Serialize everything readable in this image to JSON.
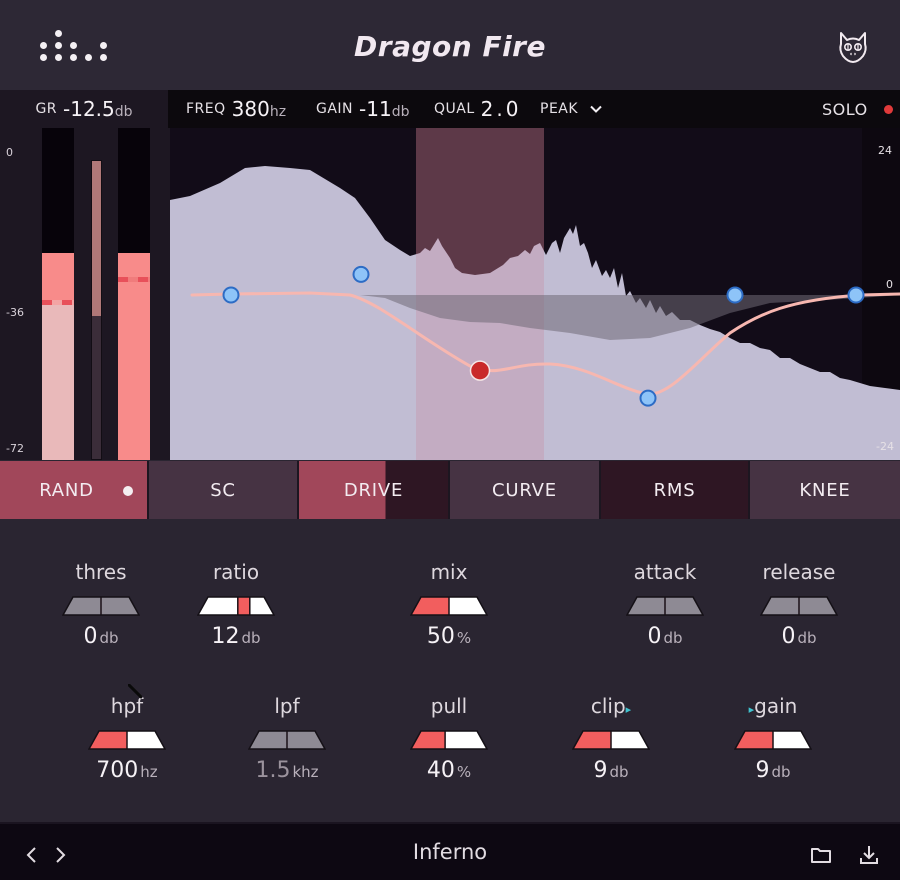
{
  "app": {
    "title": "Dragon Fire",
    "logo_icon": "dot-matrix-logo",
    "brand_icon": "cat-face-icon"
  },
  "infobar": {
    "gr": {
      "label": "GR",
      "value": "-12.5",
      "unit": "db"
    },
    "freq": {
      "label": "FREQ",
      "value": "380",
      "unit": "hz"
    },
    "gain": {
      "label": "GAIN",
      "value": "-11",
      "unit": "db"
    },
    "qual": {
      "label": "QUAL",
      "value": "2.0"
    },
    "filter_type": {
      "value": "PEAK",
      "icon": "chevron-down-icon"
    },
    "solo": {
      "label": "SOLO",
      "active_color": "#e03a3a"
    }
  },
  "meters": {
    "scale": [
      "0",
      "-36",
      "-72"
    ],
    "left_level_db": -27,
    "left_peak_db": -38,
    "gr_level_db": -36,
    "right_level_db": -27,
    "right_peak_db": -33
  },
  "graph": {
    "scale_right": [
      "24",
      "0",
      "-24"
    ],
    "bands": [
      {
        "id": 1,
        "gain_db": 0,
        "selected": false
      },
      {
        "id": 2,
        "gain_db": 3,
        "selected": false
      },
      {
        "id": 3,
        "gain_db": -11,
        "selected": true
      },
      {
        "id": 4,
        "gain_db": -15,
        "selected": false
      },
      {
        "id": 5,
        "gain_db": 0,
        "selected": false
      },
      {
        "id": 6,
        "gain_db": 0,
        "selected": false
      }
    ],
    "colors": {
      "spectrum": "#c0bcd2",
      "curve": "#f7b7b0",
      "node": "#8ec4f8",
      "node_selected": "#c92a2a",
      "selected_band": "#b07b8f"
    }
  },
  "tabs": [
    {
      "label": "RAND",
      "active": true,
      "has_dot": true
    },
    {
      "label": "SC",
      "active": false
    },
    {
      "label": "DRIVE",
      "active": true,
      "partial": 0.58
    },
    {
      "label": "CURVE",
      "active": false
    },
    {
      "label": "RMS",
      "active": false,
      "dark": true
    },
    {
      "label": "KNEE",
      "active": false
    }
  ],
  "controls": {
    "row1": [
      {
        "label": "thres",
        "value": "0",
        "unit": "db",
        "fill": 0.5,
        "style": "gray"
      },
      {
        "label": "ratio",
        "value": "12",
        "unit": "db",
        "fill": 0.6,
        "style": "marker"
      },
      {
        "label": "mix",
        "value": "50",
        "unit": "%",
        "fill": 0.5,
        "style": "red"
      },
      {
        "label": "attack",
        "value": "0",
        "unit": "db",
        "fill": 0.5,
        "style": "gray"
      },
      {
        "label": "release",
        "value": "0",
        "unit": "db",
        "fill": 0.5,
        "style": "gray"
      }
    ],
    "row2": [
      {
        "label": "hpf",
        "value": "700",
        "unit": "hz",
        "fill": 0.5,
        "style": "red"
      },
      {
        "label": "lpf",
        "value": "1.5",
        "unit": "khz",
        "fill": 0.5,
        "style": "gray"
      },
      {
        "label": "pull",
        "value": "40",
        "unit": "%",
        "fill": 0.45,
        "style": "red"
      },
      {
        "label": "clip",
        "value": "9",
        "unit": "db",
        "fill": 0.5,
        "style": "red",
        "arrow": "right"
      },
      {
        "label": "gain",
        "value": "9",
        "unit": "db",
        "fill": 0.5,
        "style": "red",
        "arrow": "left"
      }
    ],
    "arrow_glyph": "▸"
  },
  "footer": {
    "preset_name": "Inferno",
    "prev_icon": "chevron-left-icon",
    "next_icon": "chevron-right-icon",
    "folder_icon": "folder-icon",
    "download_icon": "download-icon"
  }
}
